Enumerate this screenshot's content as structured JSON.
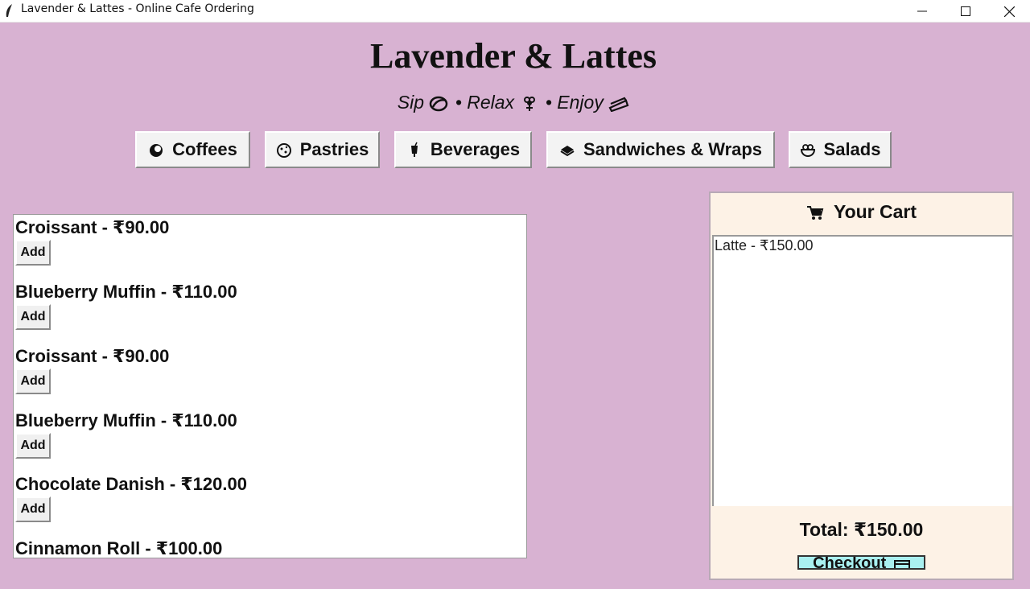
{
  "window": {
    "title": "Lavender & Lattes - Online Cafe Ordering"
  },
  "header": {
    "title": "Lavender & Lattes",
    "tagline": {
      "sip": "Sip",
      "relax": "• Relax",
      "enjoy": "• Enjoy"
    }
  },
  "categories": [
    {
      "label": "Coffees",
      "icon": "coffee-icon"
    },
    {
      "label": "Pastries",
      "icon": "cookie-icon"
    },
    {
      "label": "Beverages",
      "icon": "drink-icon"
    },
    {
      "label": "Sandwiches & Wraps",
      "icon": "sandwich-icon"
    },
    {
      "label": "Salads",
      "icon": "salad-icon"
    }
  ],
  "menu": {
    "add_label": "Add",
    "items": [
      {
        "name": "Croissant - ₹90.00"
      },
      {
        "name": "Blueberry Muffin - ₹110.00"
      },
      {
        "name": "Croissant - ₹90.00"
      },
      {
        "name": "Blueberry Muffin - ₹110.00"
      },
      {
        "name": "Chocolate Danish - ₹120.00"
      },
      {
        "name": "Cinnamon Roll - ₹100.00"
      }
    ]
  },
  "cart": {
    "title": "Your Cart",
    "items": [
      "Latte - ₹150.00"
    ],
    "total": "Total: ₹150.00",
    "checkout_label": "Checkout"
  },
  "colors": {
    "background": "#d8b2d2",
    "cart_background": "#fdf2e6",
    "checkout_button": "#a9f0f0"
  }
}
